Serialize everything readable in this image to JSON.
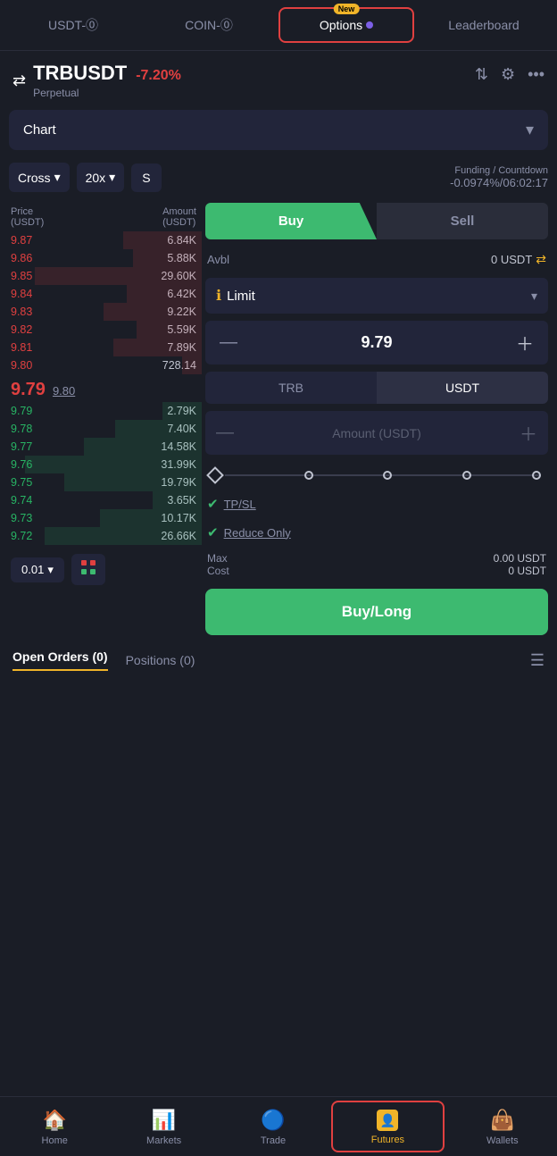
{
  "tabs": {
    "usdt": "USDT-⓪",
    "coin": "COIN-⓪",
    "options": "Options",
    "options_badge": "New",
    "leaderboard": "Leaderboard"
  },
  "pair": {
    "symbol": "TRBUSDT",
    "change": "-7.20%",
    "type": "Perpetual"
  },
  "chart": {
    "label": "Chart"
  },
  "controls": {
    "margin_type": "Cross",
    "leverage": "20x",
    "size": "S",
    "funding_label": "Funding / Countdown",
    "funding_rate": "-0.0974%/06:02:17"
  },
  "order_book": {
    "price_header": "Price\n(USDT)",
    "amount_header": "Amount\n(USDT)",
    "sell_orders": [
      {
        "price": "9.87",
        "amount": "6.84K",
        "bar": 40
      },
      {
        "price": "9.86",
        "amount": "5.88K",
        "bar": 35
      },
      {
        "price": "9.85",
        "amount": "29.60K",
        "bar": 85
      },
      {
        "price": "9.84",
        "amount": "6.42K",
        "bar": 38
      },
      {
        "price": "9.83",
        "amount": "9.22K",
        "bar": 50
      },
      {
        "price": "9.82",
        "amount": "5.59K",
        "bar": 33
      },
      {
        "price": "9.81",
        "amount": "7.89K",
        "bar": 45
      },
      {
        "price": "9.80",
        "amount": "728.14",
        "bar": 10
      }
    ],
    "mid_price": "9.79",
    "mid_ref": "9.80",
    "buy_orders": [
      {
        "price": "9.79",
        "amount": "2.79K",
        "bar": 20
      },
      {
        "price": "9.78",
        "amount": "7.40K",
        "bar": 44
      },
      {
        "price": "9.77",
        "amount": "14.58K",
        "bar": 60
      },
      {
        "price": "9.76",
        "amount": "31.99K",
        "bar": 90
      },
      {
        "price": "9.75",
        "amount": "19.79K",
        "bar": 70
      },
      {
        "price": "9.74",
        "amount": "3.65K",
        "bar": 25
      },
      {
        "price": "9.73",
        "amount": "10.17K",
        "bar": 52
      },
      {
        "price": "9.72",
        "amount": "26.66K",
        "bar": 80
      }
    ]
  },
  "trade": {
    "buy_label": "Buy",
    "sell_label": "Sell",
    "avbl_label": "Avbl",
    "avbl_value": "0 USDT",
    "order_type": "Limit",
    "price_value": "9.79",
    "currency_trb": "TRB",
    "currency_usdt": "USDT",
    "amount_placeholder": "Amount (USDT)",
    "tp_sl_label": "TP/SL",
    "reduce_only_label": "Reduce Only",
    "max_label": "Max\nCost",
    "max_value": "0.00 USDT",
    "cost_value": "0 USDT",
    "buy_long_label": "Buy/Long"
  },
  "orders": {
    "open_orders": "Open Orders (0)",
    "positions": "Positions (0)"
  },
  "bottom_nav": {
    "home": "Home",
    "markets": "Markets",
    "trade": "Trade",
    "futures": "Futures",
    "wallets": "Wallets"
  },
  "footer": {
    "lot_size": "0.01"
  }
}
